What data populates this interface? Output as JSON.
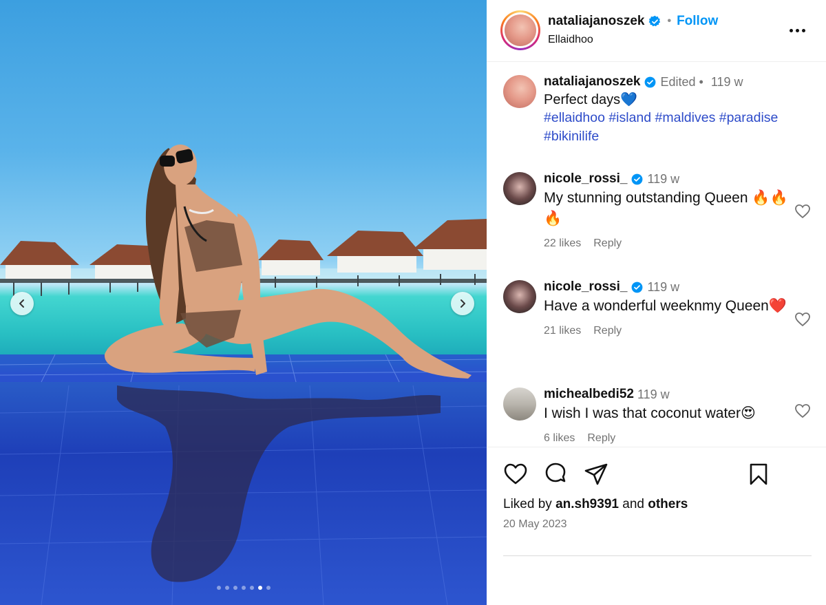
{
  "post": {
    "username": "nataliajanoszek",
    "follow_label": "Follow",
    "location": "Ellaidhoo",
    "separator": "•"
  },
  "caption": {
    "username": "nataliajanoszek",
    "edited_label": "Edited",
    "separator": "•",
    "age": "119 w",
    "text": "Perfect days💙",
    "hashtags": "#ellaidhoo #island #maldives #paradise #bikinilife"
  },
  "comments": [
    {
      "username": "nicole_rossi_",
      "age": "119 w",
      "text": "My stunning outstanding Queen 🔥🔥🔥",
      "likes": "22 likes",
      "reply_label": "Reply"
    },
    {
      "username": "nicole_rossi_",
      "age": "119 w",
      "text": "Have a wonderful weeknmy Queen❤️",
      "likes": "21 likes",
      "reply_label": "Reply"
    },
    {
      "username": "michealbedi52",
      "age": "119 w",
      "text": "I wish I was that coconut water😍",
      "likes": "6 likes",
      "reply_label": "Reply"
    }
  ],
  "liked_by": {
    "prefix": "Liked by",
    "user": "an.sh9391",
    "conjunction": "and",
    "others": "others"
  },
  "date": "20 May 2023",
  "carousel": {
    "total_slides": 7,
    "active_slide": 6
  },
  "colors": {
    "accent": "#0095f6",
    "hashtag": "#2d4bc9",
    "verified": "#0095f6",
    "muted": "#737373"
  },
  "icons": [
    "verified-badge-icon",
    "more-options-icon",
    "heart-icon",
    "comment-icon",
    "share-icon",
    "bookmark-icon",
    "chevron-left-icon",
    "chevron-right-icon"
  ]
}
